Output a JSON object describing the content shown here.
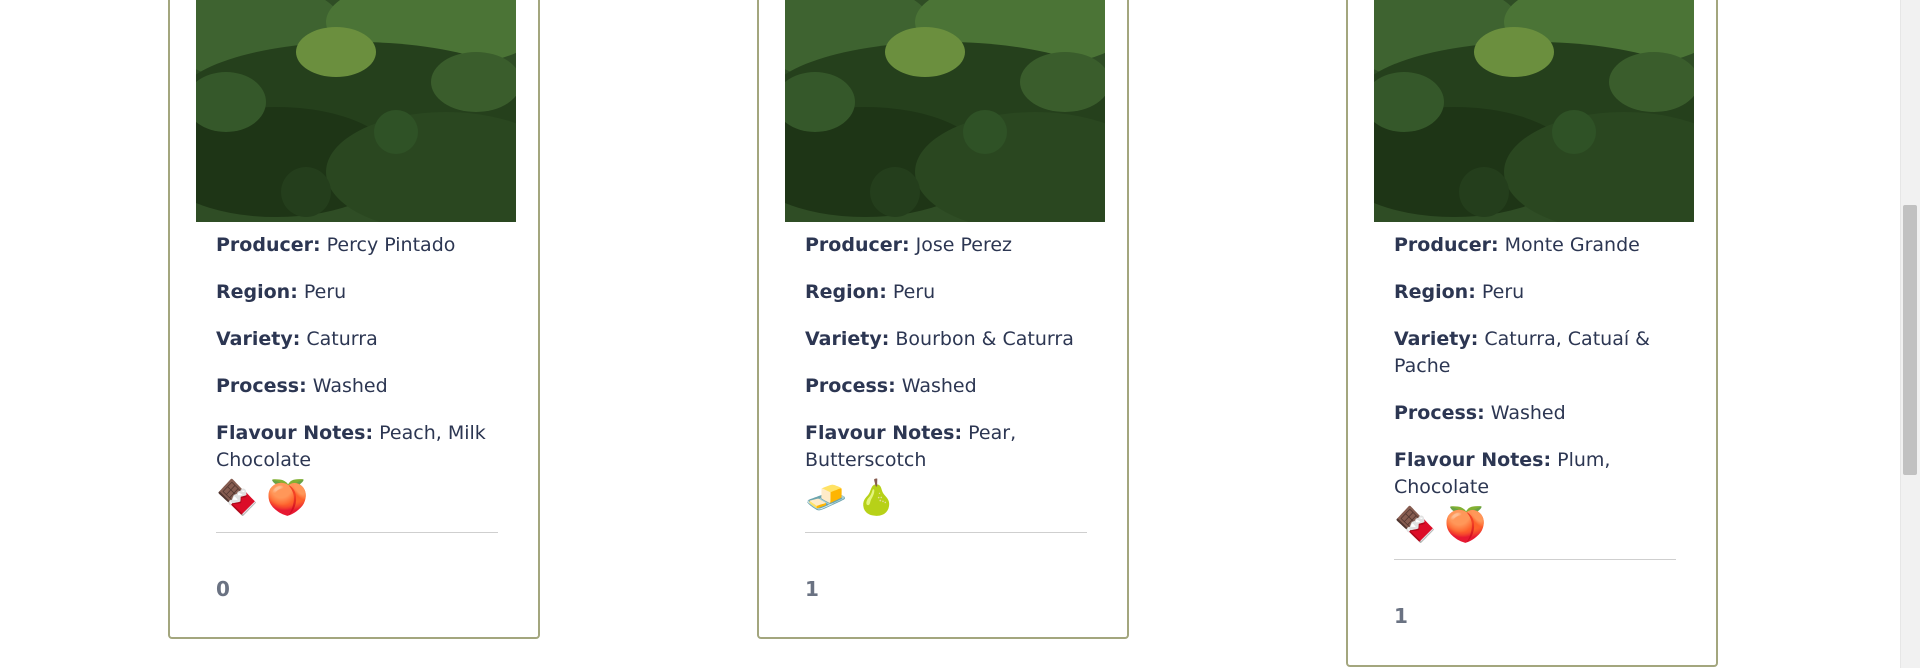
{
  "labels": {
    "producer": "Producer:",
    "region": "Region:",
    "variety": "Variety:",
    "process": "Process:",
    "flavour": "Flavour Notes:"
  },
  "cards": [
    {
      "producer": "Percy Pintado",
      "region": "Peru",
      "variety": "Caturra",
      "process": "Washed",
      "flavour_notes": "Peach, Milk Chocolate",
      "emojis": [
        "🍫",
        "🍑"
      ],
      "emoji_names": [
        "chocolate-icon",
        "peach-icon"
      ],
      "count": "0"
    },
    {
      "producer": "Jose Perez",
      "region": "Peru",
      "variety": "Bourbon & Caturra",
      "process": "Washed",
      "flavour_notes": "Pear, Butterscotch",
      "emojis": [
        "🧈",
        "🍐"
      ],
      "emoji_names": [
        "butterscotch-icon",
        "pear-icon"
      ],
      "count": "1"
    },
    {
      "producer": "Monte Grande",
      "region": "Peru",
      "variety": "Caturra, Catuaí & Pache",
      "process": "Washed",
      "flavour_notes": "Plum, Chocolate",
      "emojis": [
        "🍫",
        "🍑"
      ],
      "emoji_names": [
        "chocolate-icon",
        "plum-icon"
      ],
      "count": "1"
    }
  ],
  "colors": {
    "card_border": "#a3a67e",
    "text": "#2c3652",
    "count": "#6a7282"
  }
}
